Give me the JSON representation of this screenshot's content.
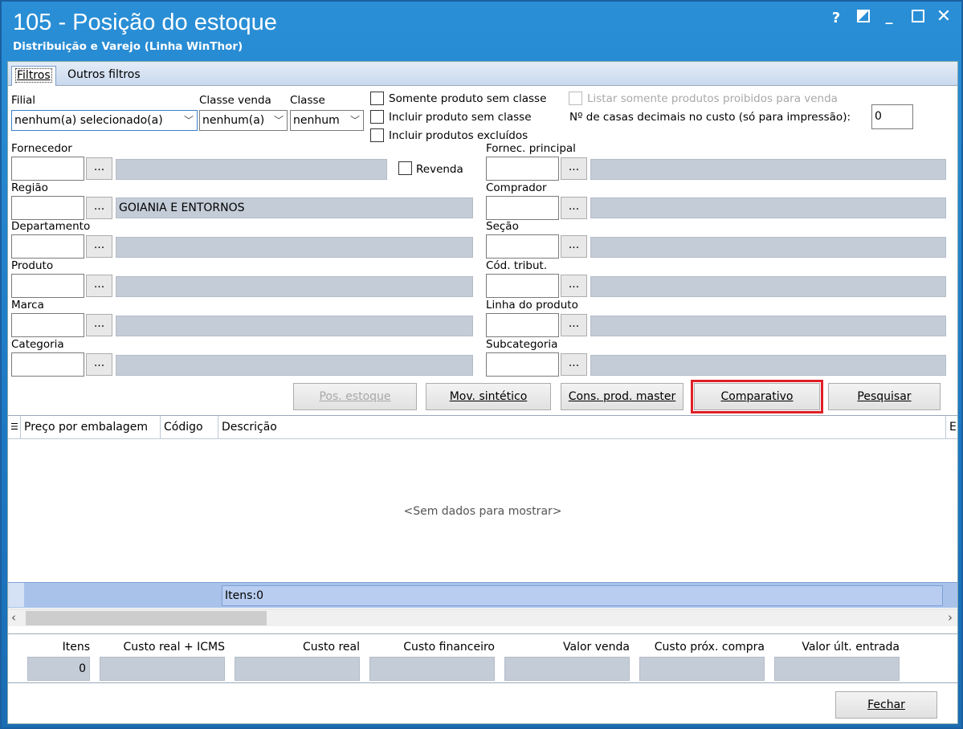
{
  "window": {
    "title": "105 - Posição do estoque",
    "subtitle": "Distribuição e Varejo (Linha WinThor)",
    "help": "?",
    "min": "_",
    "close": "✕"
  },
  "tabs": [
    {
      "label": "Filtros"
    },
    {
      "label": "Outros filtros"
    }
  ],
  "filters": {
    "filial_label": "Filial",
    "filial_value": "nenhum(a) selecionado(a)",
    "classe_venda_label": "Classe venda",
    "classe_venda_value": "nenhum(a)",
    "classe_label": "Classe",
    "classe_value": "nenhum",
    "chk_sem_classe": "Somente produto sem classe",
    "chk_incluir_sem_classe": "Incluir produto sem classe",
    "chk_excluidos": "Incluir produtos excluídos",
    "chk_proibidos": "Listar somente produtos proibidos para venda",
    "casas_label": "Nº de casas decimais no custo (só para impressão):",
    "casas_value": "0",
    "revenda": "Revenda",
    "dots": "...",
    "fornecedor": "Fornecedor",
    "regiao": "Região",
    "regiao_value": "GOIANIA E ENTORNOS",
    "departamento": "Departamento",
    "produto": "Produto",
    "marca": "Marca",
    "categoria": "Categoria",
    "fornec_principal": "Fornec. principal",
    "comprador": "Comprador",
    "secao": "Seção",
    "cod_tribut": "Cód. tribut.",
    "linha_produto": "Linha do produto",
    "subcategoria": "Subcategoria"
  },
  "buttons": {
    "pos_estoque": "Pos. estoque",
    "mov_sintetico": "Mov. sintético",
    "cons_prod_master": "Cons. prod. master",
    "comparativo": "Comparativo",
    "pesquisar": "Pesquisar",
    "fechar": "Fechar"
  },
  "grid": {
    "columns": [
      "Preço por embalagem",
      "Código",
      "Descrição",
      "E"
    ],
    "empty": "<Sem dados para mostrar>",
    "footer": "Itens:0"
  },
  "totals": {
    "labels": [
      "Itens",
      "Custo real + ICMS",
      "Custo real",
      "Custo financeiro",
      "Valor venda",
      "Custo próx. compra",
      "Valor últ. entrada"
    ],
    "itens_value": "0"
  }
}
